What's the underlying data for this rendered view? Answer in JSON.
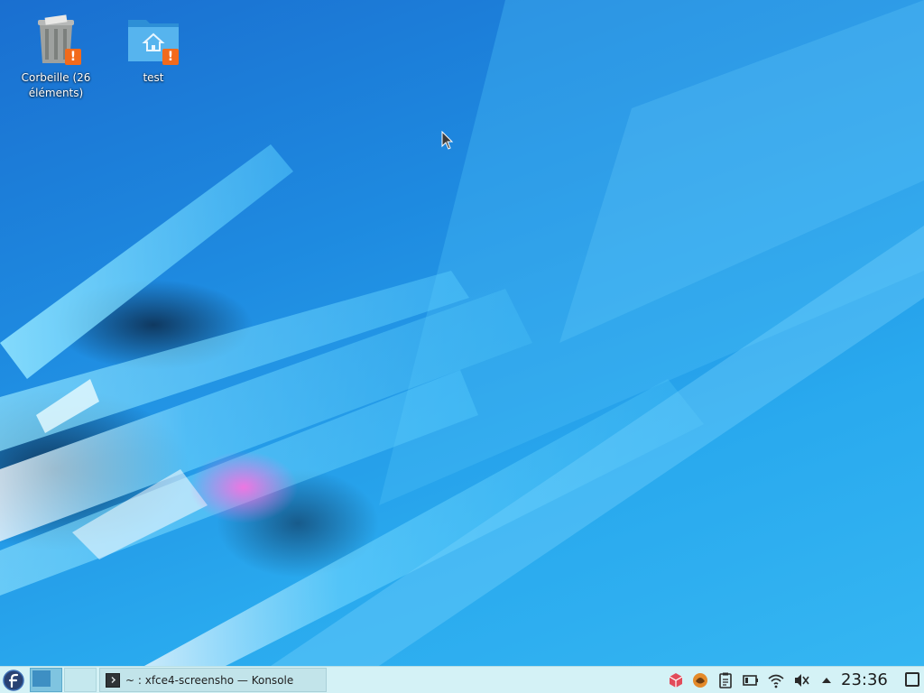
{
  "desktop": {
    "icons": [
      {
        "label": "Corbeille (26 éléments)",
        "icon": "trash-icon"
      },
      {
        "label": "test",
        "icon": "home-folder-icon"
      }
    ],
    "badge_symbol": "!",
    "badge_color": "#f26a1b"
  },
  "panel": {
    "task": {
      "label": "~ : xfce4-screensho — Konsole",
      "icon": "terminal-icon"
    },
    "tray": [
      "package-icon",
      "updates-icon",
      "clipboard-icon",
      "battery-icon",
      "wifi-icon",
      "volume-muted-icon",
      "chevron-up-icon"
    ],
    "clock": "23:36"
  },
  "colors": {
    "panel_bg": "#d4f2f6",
    "desktop_accent": "#29a9ee"
  }
}
